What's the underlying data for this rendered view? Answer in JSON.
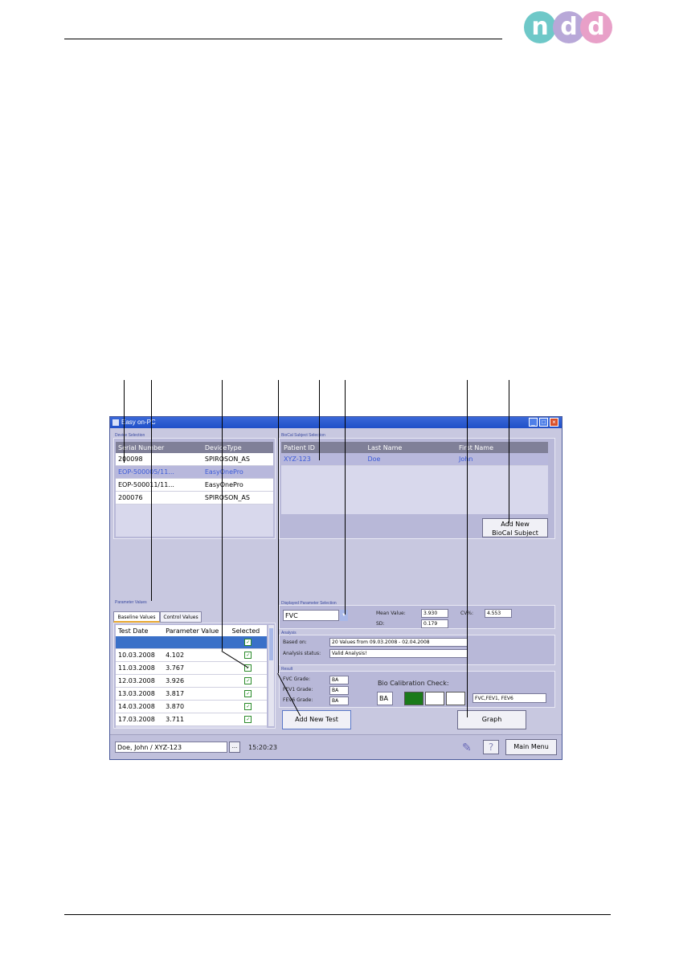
{
  "logo": {
    "letters": [
      "n",
      "d",
      "d"
    ],
    "colors": [
      "#6ec8c8",
      "#b8a8d8",
      "#e8a0c8"
    ]
  },
  "window": {
    "title": "Easy on-PC",
    "controls": [
      "_",
      "□",
      "×"
    ]
  },
  "device_selection": {
    "label": "Device Selection",
    "columns": [
      "Serial Number",
      "DeviceType"
    ],
    "rows": [
      [
        "200098",
        "SPIROSON_AS"
      ],
      [
        "EOP-500005/11...",
        "EasyOnePro"
      ],
      [
        "EOP-500011/11...",
        "EasyOnePro"
      ],
      [
        "200076",
        "SPIROSON_AS"
      ]
    ]
  },
  "biocal": {
    "label": "BioCal Subject Selection",
    "columns": [
      "Patient ID",
      "Last Name",
      "First Name"
    ],
    "rows": [
      [
        "XYZ-123",
        "Doe",
        "John"
      ]
    ],
    "add_button": [
      "Add New",
      "BioCal Subject"
    ]
  },
  "parameter_values": {
    "label": "Parameter Values",
    "tabs": [
      "Baseline Values",
      "Control Values"
    ],
    "columns": [
      "Test Date",
      "Parameter Value",
      "Selected"
    ],
    "rows": [
      [
        "",
        "",
        "✓"
      ],
      [
        "10.03.2008",
        "4.102",
        "✓"
      ],
      [
        "11.03.2008",
        "3.767",
        "✓"
      ],
      [
        "12.03.2008",
        "3.926",
        "✓"
      ],
      [
        "13.03.2008",
        "3.817",
        "✓"
      ],
      [
        "14.03.2008",
        "3.870",
        "✓"
      ],
      [
        "17.03.2008",
        "3.711",
        "✓"
      ]
    ]
  },
  "displayed_parameter": {
    "label": "Displayed Parameter Selection",
    "selected": "FVC",
    "mean_label": "Mean Value:",
    "mean_value": "3.930",
    "sd_label": "SD:",
    "sd_value": "0.179",
    "cv_label": "CV%:",
    "cv_value": "4.553"
  },
  "analysis": {
    "label": "Analysis",
    "based_on_label": "Based on:",
    "based_on_value": "20 Values from 09.03.2008 - 02.04.2008",
    "status_label": "Analysis status:",
    "status_value": "Valid Analysis!"
  },
  "result": {
    "label": "Result",
    "fvc_label": "FVC Grade:",
    "fvc_value": "BA",
    "fev1_label": "FEV1 Grade:",
    "fev1_value": "BA",
    "fev6_label": "FEV6 Grade:",
    "fev6_value": "BA",
    "bio_label": "Bio Calibration Check:",
    "bio_grade": "BA",
    "bio_params": "FVC,FEV1, FEV6",
    "bio_colors": [
      "#1a7a1a",
      "#ffffff",
      "#ffffff"
    ]
  },
  "buttons": {
    "add_test": "Add New Test",
    "graph": "Graph",
    "main_menu": "Main Menu",
    "help": "?",
    "ellipsis": "..."
  },
  "status": {
    "patient": "Doe, John / XYZ-123",
    "time": "15:20:23"
  }
}
